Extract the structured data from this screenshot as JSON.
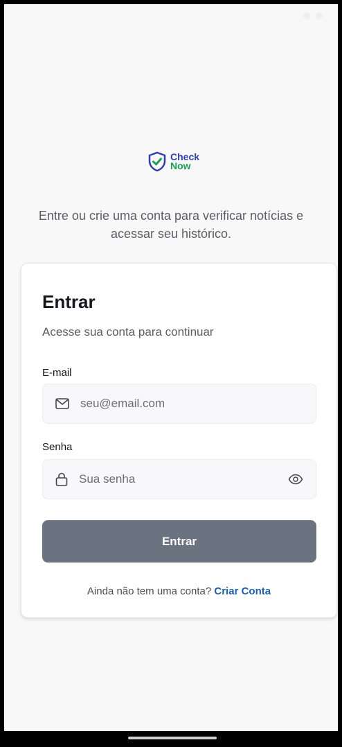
{
  "brand": {
    "name_line1": "Check",
    "name_line2": "Now"
  },
  "intro": {
    "text": "Entre ou crie uma conta para verificar notícias e acessar seu histórico."
  },
  "login_card": {
    "title": "Entrar",
    "subtitle": "Acesse sua conta para continuar",
    "email": {
      "label": "E-mail",
      "placeholder": "seu@email.com",
      "value": "",
      "icon": "mail-icon"
    },
    "password": {
      "label": "Senha",
      "placeholder": "Sua senha",
      "value": "",
      "icon": "lock-icon",
      "toggle_icon": "eye-icon"
    },
    "submit_label": "Entrar",
    "signup_prompt": "Ainda não tem uma conta?",
    "signup_link": "Criar Conta"
  },
  "colors": {
    "accent": "#1d5fa8",
    "button_bg": "#6b7280",
    "logo_blue": "#2f3ea8",
    "logo_green": "#1f9d55"
  }
}
